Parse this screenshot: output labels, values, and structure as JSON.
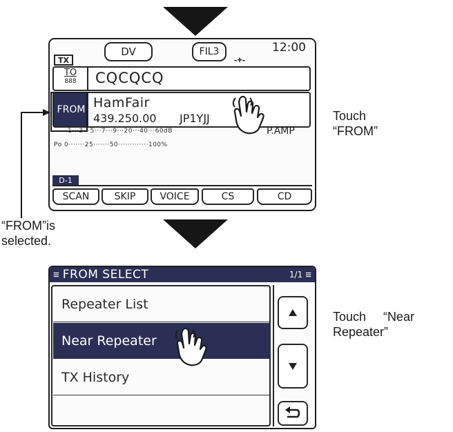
{
  "screen1": {
    "tx_indicator": "TX",
    "mode_button": "DV",
    "filter_button": "FIL3",
    "clock": "12:00",
    "to_label": "TO",
    "to_sub": "888",
    "to_value": "CQCQCQ",
    "from_label": "FROM",
    "from_name": "HamFair",
    "frequency": "439.250.00",
    "callsign": "JP1YJJ",
    "s_meter_scale": "1···3···5···7···9···20···40···60dB",
    "preamp": "P.AMP",
    "po_scale": "Po 0·······25·······50·············100%",
    "menu_tab": "D-1",
    "softkeys": [
      "SCAN",
      "SKIP",
      "VOICE",
      "CS",
      "CD"
    ]
  },
  "callout1": {
    "line1": "Touch",
    "line2": "“FROM”"
  },
  "callout_left": {
    "line1": "“FROM”is",
    "line2": "selected."
  },
  "screen2": {
    "title": "FROM SELECT",
    "page": "1/1",
    "items": [
      "Repeater List",
      "Near Repeater",
      "TX History"
    ],
    "selected_index": 1
  },
  "callout2": {
    "line1": "Touch     “Near",
    "line2": "Repeater”"
  },
  "colors": {
    "highlight": "#2b2f55",
    "ink": "#1e1e1e"
  }
}
